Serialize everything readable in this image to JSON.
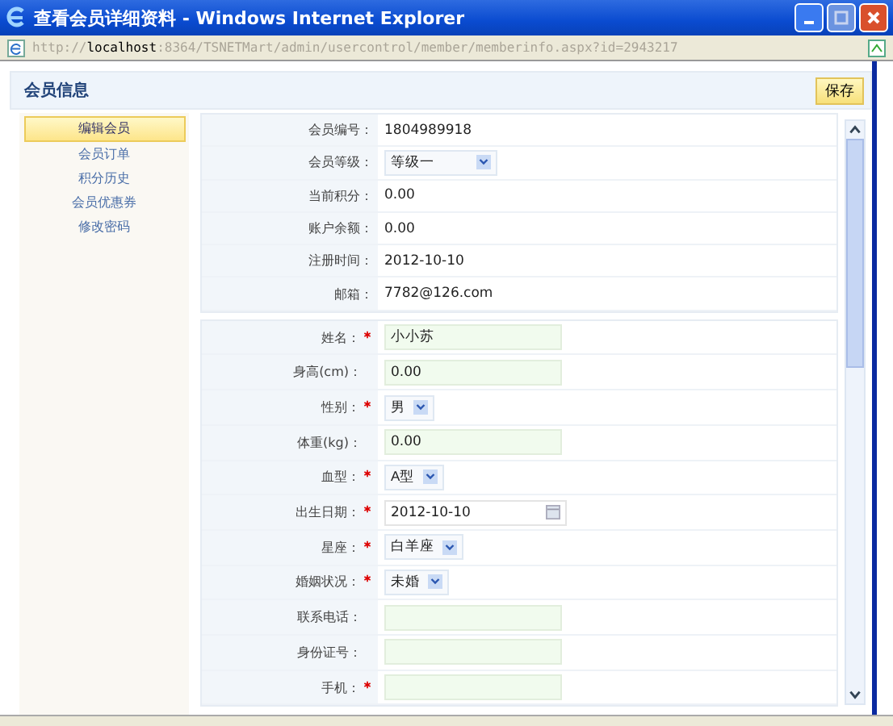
{
  "window": {
    "title": "查看会员详细资料 - Windows Internet Explorer"
  },
  "address_bar": {
    "prefix": "http://",
    "host": "localhost",
    "path": ":8364/TSNETMart/admin/usercontrol/member/memberinfo.aspx?id=2943217"
  },
  "page": {
    "title": "会员信息",
    "save_button": "保存"
  },
  "sidebar": {
    "items": [
      {
        "label": "编辑会员",
        "selected": true
      },
      {
        "label": "会员订单",
        "selected": false
      },
      {
        "label": "积分历史",
        "selected": false
      },
      {
        "label": "会员优惠券",
        "selected": false
      },
      {
        "label": "修改密码",
        "selected": false
      }
    ]
  },
  "info_rows": [
    {
      "label": "会员编号：",
      "kind": "text",
      "value": "1804989918"
    },
    {
      "label": "会员等级：",
      "kind": "select",
      "value": "等级一"
    },
    {
      "label": "当前积分：",
      "kind": "text",
      "value": "0.00"
    },
    {
      "label": "账户余额：",
      "kind": "text",
      "value": "0.00"
    },
    {
      "label": "注册时间：",
      "kind": "text",
      "value": "2012-10-10"
    },
    {
      "label": "邮箱：",
      "kind": "text",
      "value": "7782@126.com"
    }
  ],
  "form_rows": [
    {
      "label": "姓名：",
      "required": true,
      "kind": "input",
      "value": "小小苏"
    },
    {
      "label": "身高(cm)：",
      "required": false,
      "kind": "input",
      "value": "0.00"
    },
    {
      "label": "性别：",
      "required": true,
      "kind": "select",
      "value": "男"
    },
    {
      "label": "体重(kg)：",
      "required": false,
      "kind": "input",
      "value": "0.00"
    },
    {
      "label": "血型：",
      "required": true,
      "kind": "select",
      "value": "A型"
    },
    {
      "label": "出生日期：",
      "required": true,
      "kind": "date",
      "value": "2012-10-10"
    },
    {
      "label": "星座：",
      "required": true,
      "kind": "select",
      "value": "白羊座"
    },
    {
      "label": "婚姻状况：",
      "required": true,
      "kind": "select",
      "value": "未婚"
    },
    {
      "label": "联系电话：",
      "required": false,
      "kind": "input",
      "value": ""
    },
    {
      "label": "身份证号：",
      "required": false,
      "kind": "input",
      "value": ""
    },
    {
      "label": "手机：",
      "required": true,
      "kind": "input",
      "value": ""
    }
  ]
}
